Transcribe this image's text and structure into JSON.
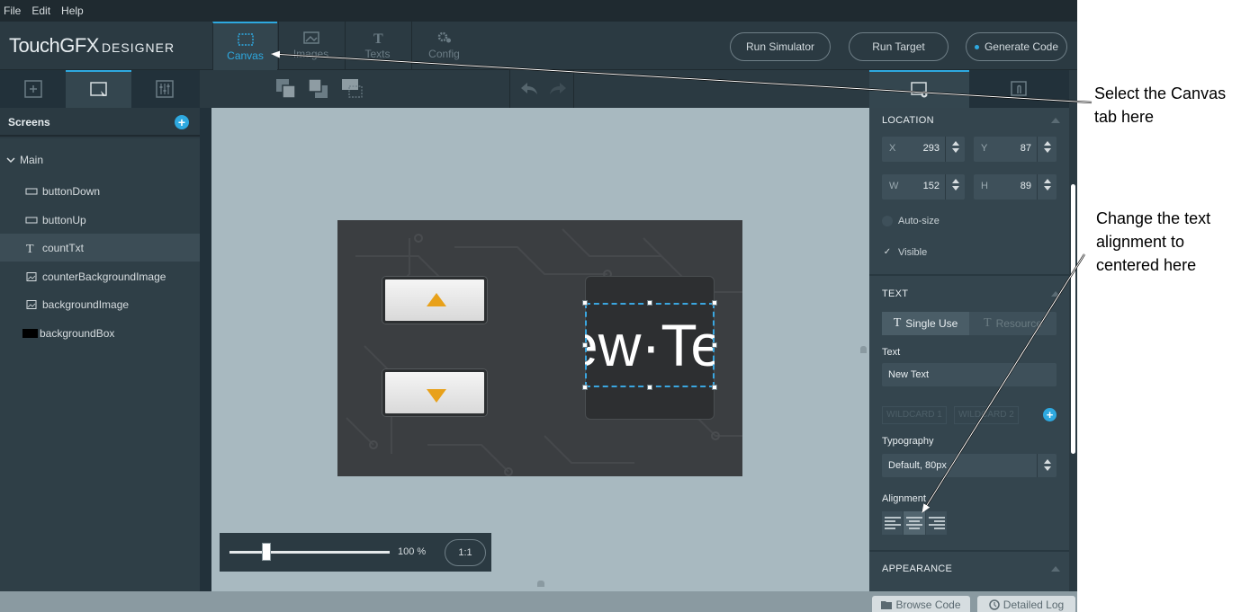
{
  "menubar": {
    "file": "File",
    "edit": "Edit",
    "help": "Help"
  },
  "header": {
    "logo_main": "TouchGFX",
    "logo_sub": "DESIGNER",
    "tabs": [
      {
        "label": "Canvas"
      },
      {
        "label": "Images"
      },
      {
        "label": "Texts"
      },
      {
        "label": "Config"
      }
    ],
    "run_simulator": "Run Simulator",
    "run_target": "Run Target",
    "generate_code": "Generate Code"
  },
  "screens": {
    "title": "Screens",
    "root": "Main",
    "items": [
      {
        "label": "buttonDown",
        "icon": "button-icon"
      },
      {
        "label": "buttonUp",
        "icon": "button-icon"
      },
      {
        "label": "countTxt",
        "icon": "text-icon"
      },
      {
        "label": "counterBackgroundImage",
        "icon": "image-icon"
      },
      {
        "label": "backgroundImage",
        "icon": "image-icon"
      },
      {
        "label": "backgroundBox",
        "icon": "box-icon"
      }
    ]
  },
  "canvas": {
    "text_preview": "ew·Te",
    "zoom": "100 %",
    "zoom_level": 0.23,
    "one_to_one": "1:1"
  },
  "properties": {
    "location": {
      "title": "LOCATION",
      "x_label": "X",
      "x": "293",
      "y_label": "Y",
      "y": "87",
      "w_label": "W",
      "w": "152",
      "h_label": "H",
      "h": "89",
      "autosize": "Auto-size",
      "visible": "Visible"
    },
    "text": {
      "title": "TEXT",
      "single_use": "Single Use",
      "resource": "Resource",
      "text_label": "Text",
      "text_value": "New Text",
      "wildcard1": "WILDCARD 1",
      "wildcard2": "WILDCARD 2",
      "typography_label": "Typography",
      "typography_value": "Default, 80px",
      "alignment_label": "Alignment"
    },
    "appearance": {
      "title": "APPEARANCE"
    }
  },
  "bottom": {
    "browse_code": "Browse Code",
    "detailed_log": "Detailed Log"
  },
  "annotations": {
    "canvas_note_1": "Select the Canvas",
    "canvas_note_2": "tab here",
    "align_note_1": "Change the text",
    "align_note_2": "alignment to",
    "align_note_3": "centered here"
  },
  "colors": {
    "accent": "#2ea9e0",
    "panel": "#34454e",
    "canvas_bg": "#a8b9c0",
    "arrow_orange": "#f0a020"
  }
}
